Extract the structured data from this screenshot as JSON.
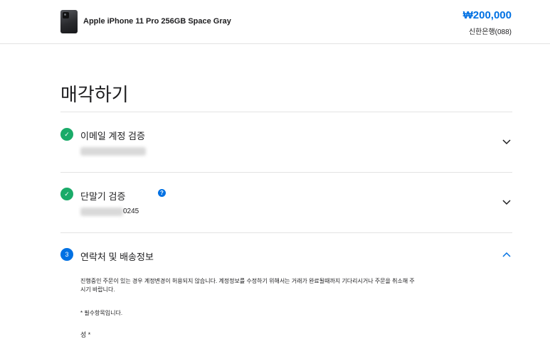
{
  "header": {
    "product_name": "Apple iPhone 11 Pro 256GB Space Gray",
    "price": "₩200,000",
    "bank": "신한은행(088)"
  },
  "page": {
    "title": "매각하기"
  },
  "steps": [
    {
      "badge": "✓",
      "title": "이메일 계정 검증",
      "value": "",
      "state": "completed"
    },
    {
      "badge": "✓",
      "title": "단말기 검증",
      "value": "0245",
      "state": "completed",
      "help_icon": "?"
    },
    {
      "badge": "3",
      "title": "연락처 및 배송정보",
      "state": "active"
    }
  ],
  "contact": {
    "notice": "진행중인 주문이 있는 경우 계정변경이 허용되지 않습니다. 계정정보를 수정하기 위해서는 거래가 완료될때까지 기다리시거나 주문을 취소해 주시기 바랍니다.",
    "required_note": "* 필수항목입니다.",
    "last_name_label": "성 *"
  },
  "colors": {
    "accent": "#0071e3",
    "success": "#1aab69",
    "divider": "#e3e3e3"
  },
  "icons": [
    "phone-thumbnail",
    "check-icon",
    "help-icon",
    "chevron-down-icon",
    "chevron-up-icon"
  ]
}
